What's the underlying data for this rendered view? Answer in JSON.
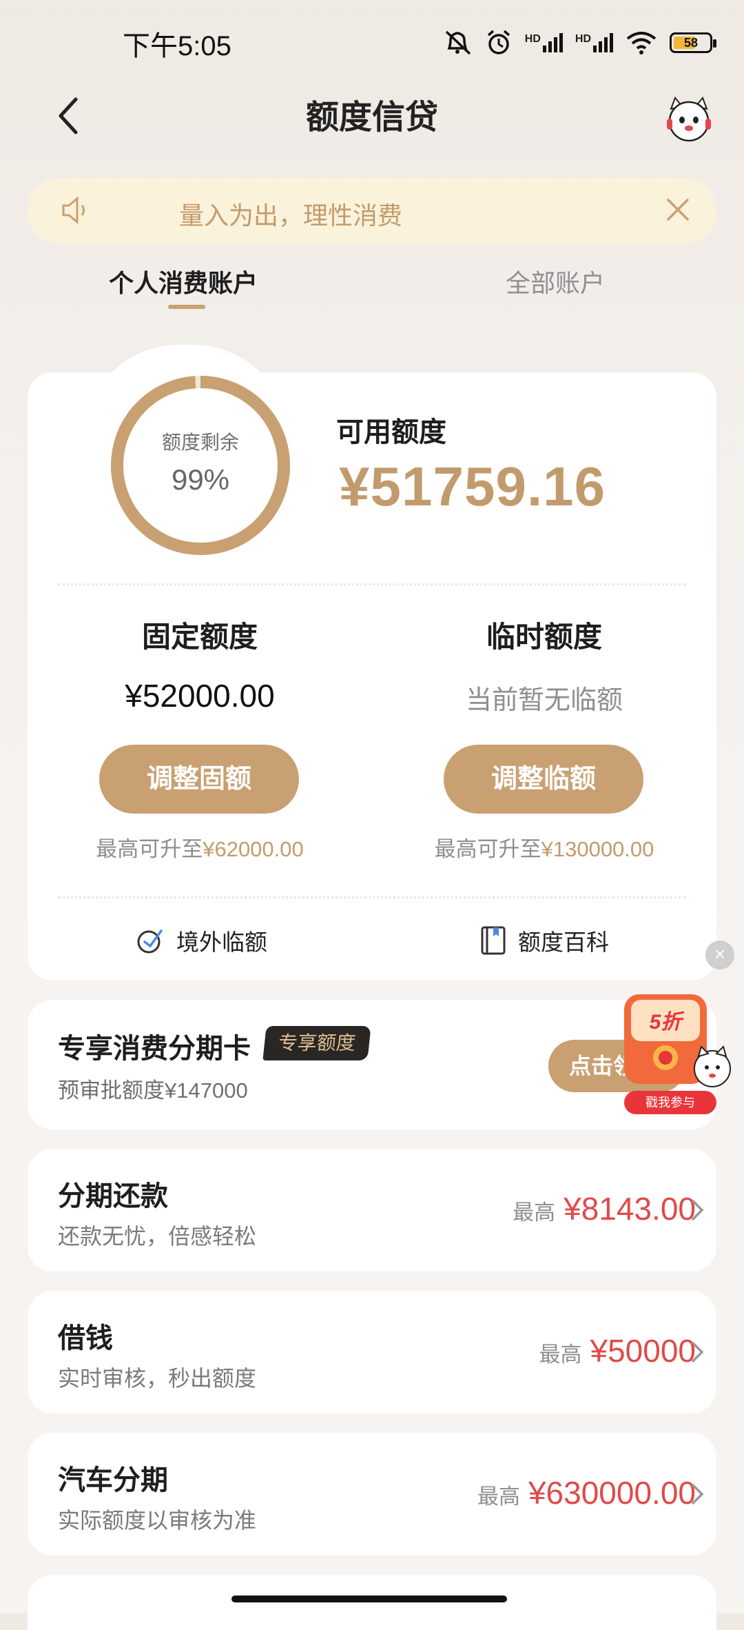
{
  "status": {
    "time": "下午5:05",
    "hd1": "HD",
    "hd2": "HD",
    "battery": "58"
  },
  "header": {
    "title": "额度信贷"
  },
  "notice": {
    "text": "量入为出，理性消费"
  },
  "tabs": [
    {
      "label": "个人消费账户",
      "active": true
    },
    {
      "label": "全部账户",
      "active": false
    }
  ],
  "credit": {
    "ring_label": "额度剩余",
    "ring_percent": "99%",
    "ring_fraction": 0.99,
    "available_label": "可用额度",
    "available_amount": "¥51759.16",
    "fixed": {
      "label": "固定额度",
      "value": "¥52000.00",
      "button": "调整固额",
      "max_prefix": "最高可升至",
      "max_value": "¥62000.00"
    },
    "temp": {
      "label": "临时额度",
      "value": "当前暂无临额",
      "button": "调整临额",
      "max_prefix": "最高可升至",
      "max_value": "¥130000.00"
    },
    "links": {
      "overseas": "境外临额",
      "wiki": "额度百科"
    }
  },
  "installment_card": {
    "title": "专享消费分期卡",
    "tag": "专享额度",
    "subtitle": "预审批额度¥147000",
    "button": "点击领"
  },
  "promo": {
    "discount": "5折",
    "badge": "戳我参与",
    "close": "×"
  },
  "list": [
    {
      "title": "分期还款",
      "subtitle": "还款无忧，倍感轻松",
      "prefix": "最高",
      "amount": "¥8143.00"
    },
    {
      "title": "借钱",
      "subtitle": "实时审核，秒出额度",
      "prefix": "最高",
      "amount": "¥50000"
    },
    {
      "title": "汽车分期",
      "subtitle": "实际额度以审核为准",
      "prefix": "最高",
      "amount": "¥630000.00"
    }
  ],
  "colors": {
    "gold": "#c9a072",
    "gold_text": "#c29b6c",
    "red_amount": "#df4a4a",
    "notice_bg": "#fbf2dc"
  }
}
